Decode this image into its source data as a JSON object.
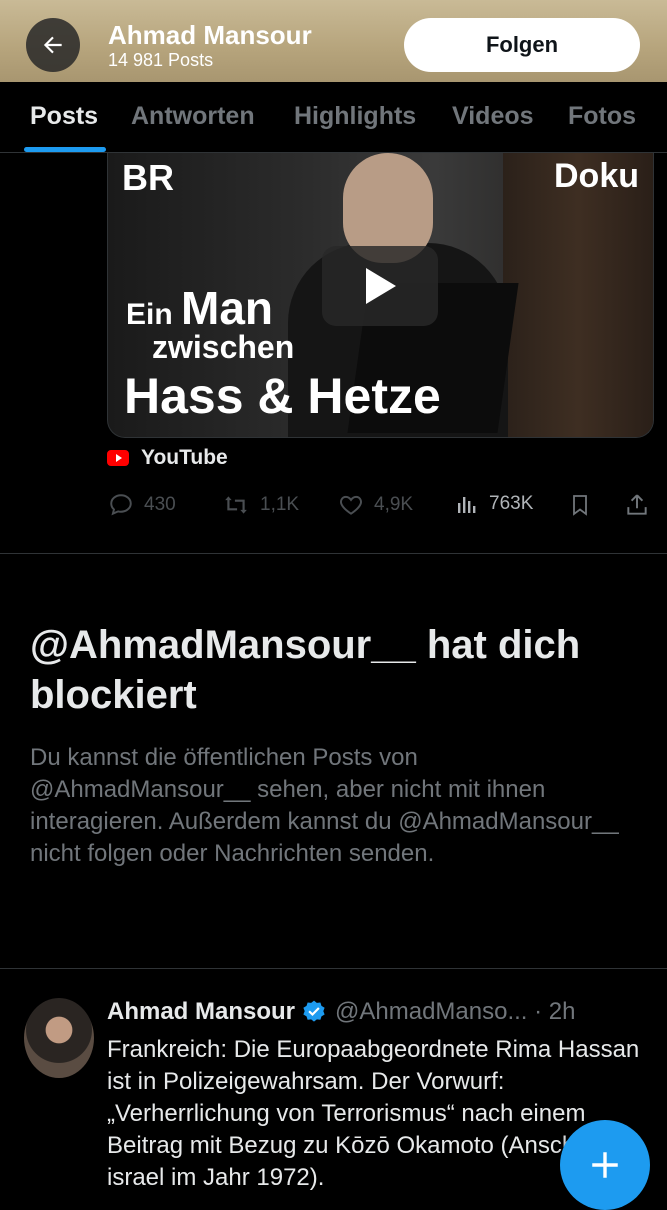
{
  "header": {
    "name": "Ahmad Mansour",
    "posts_count": "14 981 Posts",
    "follow_label": "Folgen",
    "back_icon": "arrow-left-icon"
  },
  "tabs": [
    {
      "label": "Posts",
      "active": true
    },
    {
      "label": "Antworten",
      "active": false
    },
    {
      "label": "Highlights",
      "active": false
    },
    {
      "label": "Videos",
      "active": false
    },
    {
      "label": "Fotos",
      "active": false
    }
  ],
  "video_card": {
    "logo": "BR",
    "corner_label": "Doku",
    "title_line1_small": "Ein ",
    "title_line1_big": "Man",
    "title_line2": "zwischen",
    "title_line3": "Hass & Hetze",
    "source": "YouTube"
  },
  "post_actions": {
    "replies": "430",
    "reposts": "1,1K",
    "likes": "4,9K",
    "views": "763K"
  },
  "blocked": {
    "title": "@AhmadMansour__ hat dich blockiert",
    "description": "Du kannst die öffentlichen Posts von @AhmadMansour__ sehen, aber nicht mit ihnen interagieren. Außerdem kannst du @AhmadMansour__ nicht folgen oder Nachrichten senden."
  },
  "tweet": {
    "author": "Ahmad Mansour",
    "verified": true,
    "handle_time": "@AhmadManso... · 2h",
    "text": "Frankreich: Die Europaabgeordnete Rima Hassan ist in Polizeigewahrsam. Der Vorwurf: „Verherrlichung von Terrorismus“ nach einem Beitrag mit Bezug zu Kōzō Okamoto (Anschlag in israel im Jahr 1972)."
  },
  "colors": {
    "accent": "#1d9bf0",
    "background": "#000000",
    "banner": "#b6a47c",
    "muted": "#71767b"
  }
}
